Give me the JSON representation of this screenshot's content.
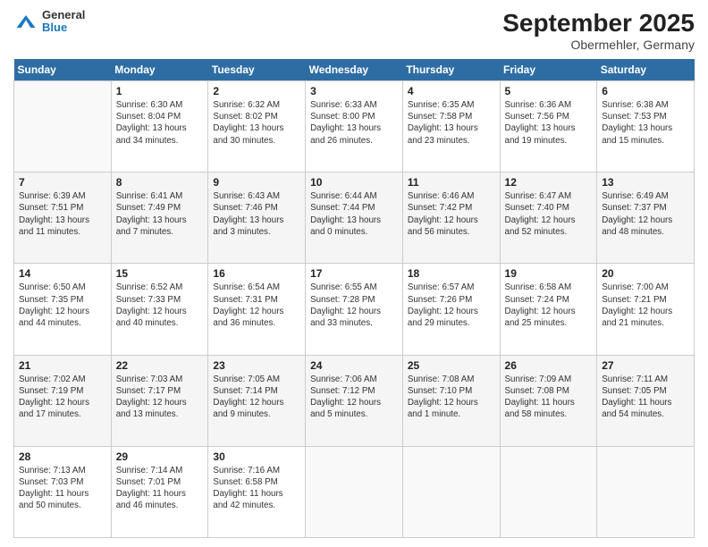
{
  "header": {
    "logo_line1": "General",
    "logo_line2": "Blue",
    "month": "September 2025",
    "location": "Obermehler, Germany"
  },
  "days_of_week": [
    "Sunday",
    "Monday",
    "Tuesday",
    "Wednesday",
    "Thursday",
    "Friday",
    "Saturday"
  ],
  "weeks": [
    [
      {
        "num": "",
        "info": ""
      },
      {
        "num": "1",
        "info": "Sunrise: 6:30 AM\nSunset: 8:04 PM\nDaylight: 13 hours\nand 34 minutes."
      },
      {
        "num": "2",
        "info": "Sunrise: 6:32 AM\nSunset: 8:02 PM\nDaylight: 13 hours\nand 30 minutes."
      },
      {
        "num": "3",
        "info": "Sunrise: 6:33 AM\nSunset: 8:00 PM\nDaylight: 13 hours\nand 26 minutes."
      },
      {
        "num": "4",
        "info": "Sunrise: 6:35 AM\nSunset: 7:58 PM\nDaylight: 13 hours\nand 23 minutes."
      },
      {
        "num": "5",
        "info": "Sunrise: 6:36 AM\nSunset: 7:56 PM\nDaylight: 13 hours\nand 19 minutes."
      },
      {
        "num": "6",
        "info": "Sunrise: 6:38 AM\nSunset: 7:53 PM\nDaylight: 13 hours\nand 15 minutes."
      }
    ],
    [
      {
        "num": "7",
        "info": "Sunrise: 6:39 AM\nSunset: 7:51 PM\nDaylight: 13 hours\nand 11 minutes."
      },
      {
        "num": "8",
        "info": "Sunrise: 6:41 AM\nSunset: 7:49 PM\nDaylight: 13 hours\nand 7 minutes."
      },
      {
        "num": "9",
        "info": "Sunrise: 6:43 AM\nSunset: 7:46 PM\nDaylight: 13 hours\nand 3 minutes."
      },
      {
        "num": "10",
        "info": "Sunrise: 6:44 AM\nSunset: 7:44 PM\nDaylight: 13 hours\nand 0 minutes."
      },
      {
        "num": "11",
        "info": "Sunrise: 6:46 AM\nSunset: 7:42 PM\nDaylight: 12 hours\nand 56 minutes."
      },
      {
        "num": "12",
        "info": "Sunrise: 6:47 AM\nSunset: 7:40 PM\nDaylight: 12 hours\nand 52 minutes."
      },
      {
        "num": "13",
        "info": "Sunrise: 6:49 AM\nSunset: 7:37 PM\nDaylight: 12 hours\nand 48 minutes."
      }
    ],
    [
      {
        "num": "14",
        "info": "Sunrise: 6:50 AM\nSunset: 7:35 PM\nDaylight: 12 hours\nand 44 minutes."
      },
      {
        "num": "15",
        "info": "Sunrise: 6:52 AM\nSunset: 7:33 PM\nDaylight: 12 hours\nand 40 minutes."
      },
      {
        "num": "16",
        "info": "Sunrise: 6:54 AM\nSunset: 7:31 PM\nDaylight: 12 hours\nand 36 minutes."
      },
      {
        "num": "17",
        "info": "Sunrise: 6:55 AM\nSunset: 7:28 PM\nDaylight: 12 hours\nand 33 minutes."
      },
      {
        "num": "18",
        "info": "Sunrise: 6:57 AM\nSunset: 7:26 PM\nDaylight: 12 hours\nand 29 minutes."
      },
      {
        "num": "19",
        "info": "Sunrise: 6:58 AM\nSunset: 7:24 PM\nDaylight: 12 hours\nand 25 minutes."
      },
      {
        "num": "20",
        "info": "Sunrise: 7:00 AM\nSunset: 7:21 PM\nDaylight: 12 hours\nand 21 minutes."
      }
    ],
    [
      {
        "num": "21",
        "info": "Sunrise: 7:02 AM\nSunset: 7:19 PM\nDaylight: 12 hours\nand 17 minutes."
      },
      {
        "num": "22",
        "info": "Sunrise: 7:03 AM\nSunset: 7:17 PM\nDaylight: 12 hours\nand 13 minutes."
      },
      {
        "num": "23",
        "info": "Sunrise: 7:05 AM\nSunset: 7:14 PM\nDaylight: 12 hours\nand 9 minutes."
      },
      {
        "num": "24",
        "info": "Sunrise: 7:06 AM\nSunset: 7:12 PM\nDaylight: 12 hours\nand 5 minutes."
      },
      {
        "num": "25",
        "info": "Sunrise: 7:08 AM\nSunset: 7:10 PM\nDaylight: 12 hours\nand 1 minute."
      },
      {
        "num": "26",
        "info": "Sunrise: 7:09 AM\nSunset: 7:08 PM\nDaylight: 11 hours\nand 58 minutes."
      },
      {
        "num": "27",
        "info": "Sunrise: 7:11 AM\nSunset: 7:05 PM\nDaylight: 11 hours\nand 54 minutes."
      }
    ],
    [
      {
        "num": "28",
        "info": "Sunrise: 7:13 AM\nSunset: 7:03 PM\nDaylight: 11 hours\nand 50 minutes."
      },
      {
        "num": "29",
        "info": "Sunrise: 7:14 AM\nSunset: 7:01 PM\nDaylight: 11 hours\nand 46 minutes."
      },
      {
        "num": "30",
        "info": "Sunrise: 7:16 AM\nSunset: 6:58 PM\nDaylight: 11 hours\nand 42 minutes."
      },
      {
        "num": "",
        "info": ""
      },
      {
        "num": "",
        "info": ""
      },
      {
        "num": "",
        "info": ""
      },
      {
        "num": "",
        "info": ""
      }
    ]
  ]
}
